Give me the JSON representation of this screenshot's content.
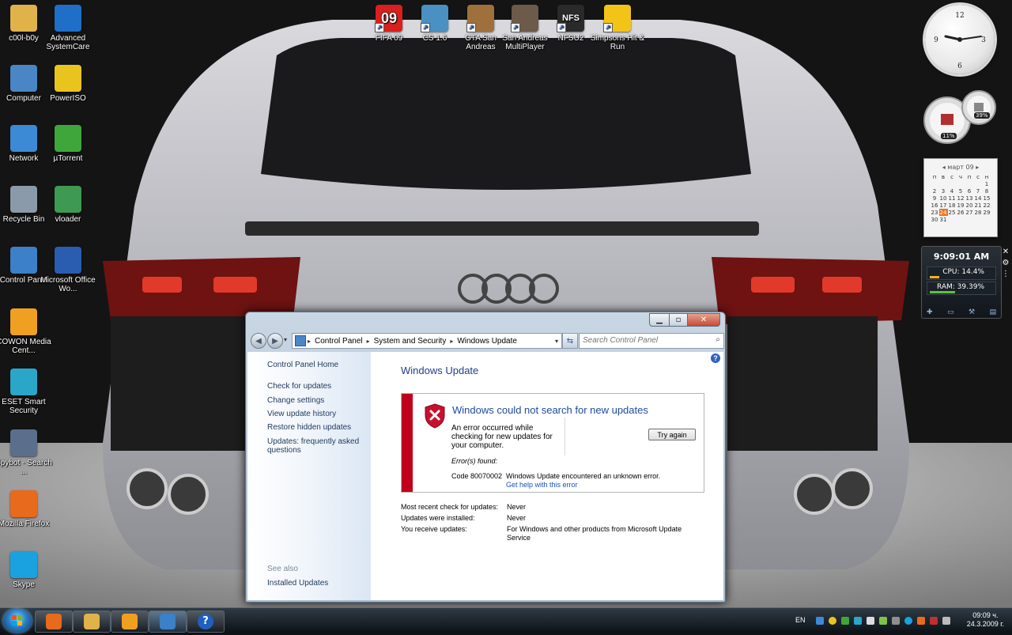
{
  "desktop": {
    "icons": [
      {
        "label": "c00l-b0y",
        "icon": "folder-icon",
        "color": "#e0b24a"
      },
      {
        "label": "Advanced SystemCare",
        "icon": "advanced-systemcare-icon",
        "color": "#1f6fc9"
      },
      {
        "label": "Computer",
        "icon": "computer-icon",
        "color": "#4a86c5"
      },
      {
        "label": "PowerISO",
        "icon": "poweriso-icon",
        "color": "#e9c41f"
      },
      {
        "label": "Network",
        "icon": "network-icon",
        "color": "#3c8ad6"
      },
      {
        "label": "µTorrent",
        "icon": "utorrent-icon",
        "color": "#3fa63c"
      },
      {
        "label": "Recycle Bin",
        "icon": "recycle-bin-icon",
        "color": "#8a9aa8"
      },
      {
        "label": "vloader",
        "icon": "vloader-icon",
        "color": "#3e9a52"
      },
      {
        "label": "Control Panel",
        "icon": "control-panel-icon",
        "color": "#3b80c8"
      },
      {
        "label": "Microsoft Office Wo...",
        "icon": "word-icon",
        "color": "#2a5db0"
      },
      {
        "label": "COWON Media Cent...",
        "icon": "cowon-icon",
        "color": "#f0a020"
      },
      {
        "label": "ESET Smart Security",
        "icon": "eset-icon",
        "color": "#2aa6c9"
      },
      {
        "label": "Spybot - Search ...",
        "icon": "spybot-icon",
        "color": "#5b6e8c"
      },
      {
        "label": "Mozilla Firefox",
        "icon": "firefox-icon",
        "color": "#e86a1c"
      },
      {
        "label": "Skype",
        "icon": "skype-icon",
        "color": "#1aa1e0"
      }
    ],
    "top_icons": [
      {
        "label": "FIFA 09",
        "glyph": "09",
        "icon": "fifa-icon",
        "color": "#d8201c"
      },
      {
        "label": "CS 1.6",
        "glyph": "",
        "icon": "cs-icon",
        "color": "#4a90c2"
      },
      {
        "label": "GTA San Andreas",
        "glyph": "",
        "icon": "gta-icon",
        "color": "#a0703c"
      },
      {
        "label": "San Andreas MultiPlayer",
        "glyph": "",
        "icon": "samp-icon",
        "color": "#6c5a4a"
      },
      {
        "label": "NFSU2",
        "glyph": "NFS",
        "icon": "nfs-icon",
        "color": "#2a2a2a"
      },
      {
        "label": "Simpsons Hit & Run",
        "glyph": "",
        "icon": "simpsons-icon",
        "color": "#f2c418"
      }
    ]
  },
  "gadgets": {
    "cpu_meter": {
      "cpu": "11%",
      "ram": "39%"
    },
    "calendar": {
      "month": "март 09",
      "weekdays": [
        "п",
        "в",
        "с",
        "ч",
        "п",
        "с",
        "н"
      ],
      "weeks": [
        [
          "",
          "",
          "",
          "",
          "",
          "",
          "1"
        ],
        [
          "2",
          "3",
          "4",
          "5",
          "6",
          "7",
          "8"
        ],
        [
          "9",
          "10",
          "11",
          "12",
          "13",
          "14",
          "15"
        ],
        [
          "16",
          "17",
          "18",
          "19",
          "20",
          "21",
          "22"
        ],
        [
          "23",
          "24",
          "25",
          "26",
          "27",
          "28",
          "29"
        ],
        [
          "30",
          "31",
          "",
          "",
          "",
          "",
          ""
        ]
      ],
      "today": "24"
    },
    "sysmon": {
      "time": "9:09:01 AM",
      "cpu_label": "CPU: 14.4%",
      "ram_label": "RAM: 39.39%",
      "cpu_level": 0.144,
      "ram_level": 0.3939
    }
  },
  "window": {
    "address": {
      "crumbs": [
        "Control Panel",
        "System and Security",
        "Windows Update"
      ]
    },
    "search": {
      "placeholder": "Search Control Panel"
    },
    "left_pane": {
      "home": "Control Panel Home",
      "links": [
        "Check for updates",
        "Change settings",
        "View update history",
        "Restore hidden updates",
        "Updates: frequently asked questions"
      ],
      "see_also_heading": "See also",
      "see_also_links": [
        "Installed Updates"
      ]
    },
    "main": {
      "title": "Windows Update",
      "error": {
        "title": "Windows could not search for new updates",
        "description": "An error occurred while checking for new updates for your computer.",
        "errors_found_label": "Error(s) found:",
        "code": "Code 80070002",
        "message": "Windows Update encountered an unknown error.",
        "help_link": "Get help with this error",
        "try_again_label": "Try again"
      },
      "info": [
        {
          "label": "Most recent check for updates:",
          "value": "Never"
        },
        {
          "label": "Updates were installed:",
          "value": "Never"
        },
        {
          "label": "You receive updates:",
          "value": "For Windows and other products from Microsoft Update Service"
        }
      ]
    }
  },
  "taskbar": {
    "apps": [
      {
        "name": "firefox",
        "icon": "firefox-icon",
        "color": "#e86a1c"
      },
      {
        "name": "explorer",
        "icon": "folder-icon",
        "color": "#e0b24a"
      },
      {
        "name": "cowon",
        "icon": "cowon-icon",
        "color": "#f0a020"
      },
      {
        "name": "control-panel",
        "icon": "control-panel-icon",
        "color": "#3b80c8"
      },
      {
        "name": "help",
        "icon": "help-icon",
        "color": "#1f5fc0"
      }
    ],
    "language": "EN",
    "time": "09:09 ч.",
    "date": "24.3.2009 г."
  }
}
